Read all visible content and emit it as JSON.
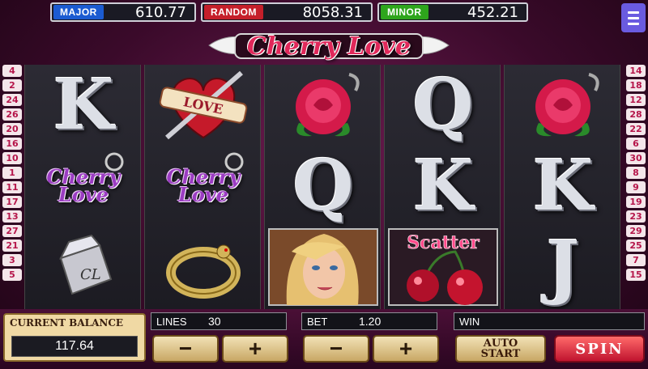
{
  "jackpots": [
    {
      "label": "MAJOR",
      "value": "610.77",
      "color": "#1b5bd1"
    },
    {
      "label": "RANDOM",
      "value": "8058.31",
      "color": "#c51f2a"
    },
    {
      "label": "MINOR",
      "value": "452.21",
      "color": "#2ea51c"
    }
  ],
  "menu_icon": "hamburger-menu-icon",
  "logo": {
    "text": "Cherry Love"
  },
  "left_lines": [
    "4",
    "2",
    "24",
    "26",
    "20",
    "16",
    "10",
    "1",
    "11",
    "17",
    "13",
    "27",
    "21",
    "3",
    "5"
  ],
  "right_lines": [
    "14",
    "18",
    "12",
    "28",
    "22",
    "6",
    "30",
    "8",
    "9",
    "19",
    "23",
    "29",
    "25",
    "7",
    "15"
  ],
  "reels": [
    [
      "K",
      "cherry-love-keychain",
      "lighter"
    ],
    [
      "heart-dagger",
      "cherry-love-keychain",
      "snake-ring"
    ],
    [
      "rose",
      "Q",
      "woman"
    ],
    [
      "Q",
      "K",
      "scatter-cherries"
    ],
    [
      "rose",
      "K",
      "J"
    ]
  ],
  "symbols": {
    "heart_banner": "LOVE",
    "keychain_line1": "Cherry",
    "keychain_line2": "Love",
    "lighter_mark": "CL",
    "scatter": "Scatter"
  },
  "balance": {
    "label": "CURRENT BALANCE",
    "value": "117.64"
  },
  "lines": {
    "label": "LINES",
    "value": "30"
  },
  "bet": {
    "label": "BET",
    "value": "1.20"
  },
  "win": {
    "label": "WIN",
    "value": ""
  },
  "buttons": {
    "minus": "−",
    "plus": "+",
    "auto_line1": "AUTO",
    "auto_line2": "START",
    "spin": "SPIN"
  }
}
